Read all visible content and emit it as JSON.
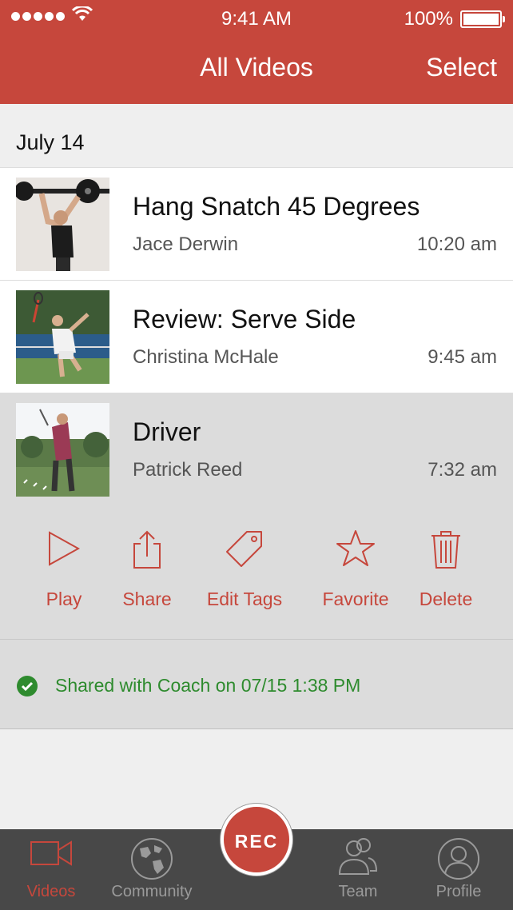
{
  "status_bar": {
    "time": "9:41 AM",
    "battery": "100%"
  },
  "nav": {
    "title": "All Videos",
    "select_label": "Select"
  },
  "section": {
    "date": "July 14"
  },
  "videos": [
    {
      "title": "Hang Snatch 45 Degrees",
      "person": "Jace Derwin",
      "time": "10:20 am"
    },
    {
      "title": "Review: Serve Side",
      "person": "Christina McHale",
      "time": "9:45 am"
    },
    {
      "title": "Driver",
      "person": "Patrick Reed",
      "time": "7:32 am"
    }
  ],
  "actions": {
    "play": "Play",
    "share": "Share",
    "edit_tags": "Edit Tags",
    "favorite": "Favorite",
    "delete": "Delete"
  },
  "shared_status": "Shared with Coach on 07/15 1:38 PM",
  "tabs": {
    "videos": "Videos",
    "community": "Community",
    "rec": "REC",
    "team": "Team",
    "profile": "Profile"
  },
  "colors": {
    "brand": "#c6473c",
    "success": "#2e8b2e",
    "tabbar": "#484848"
  }
}
